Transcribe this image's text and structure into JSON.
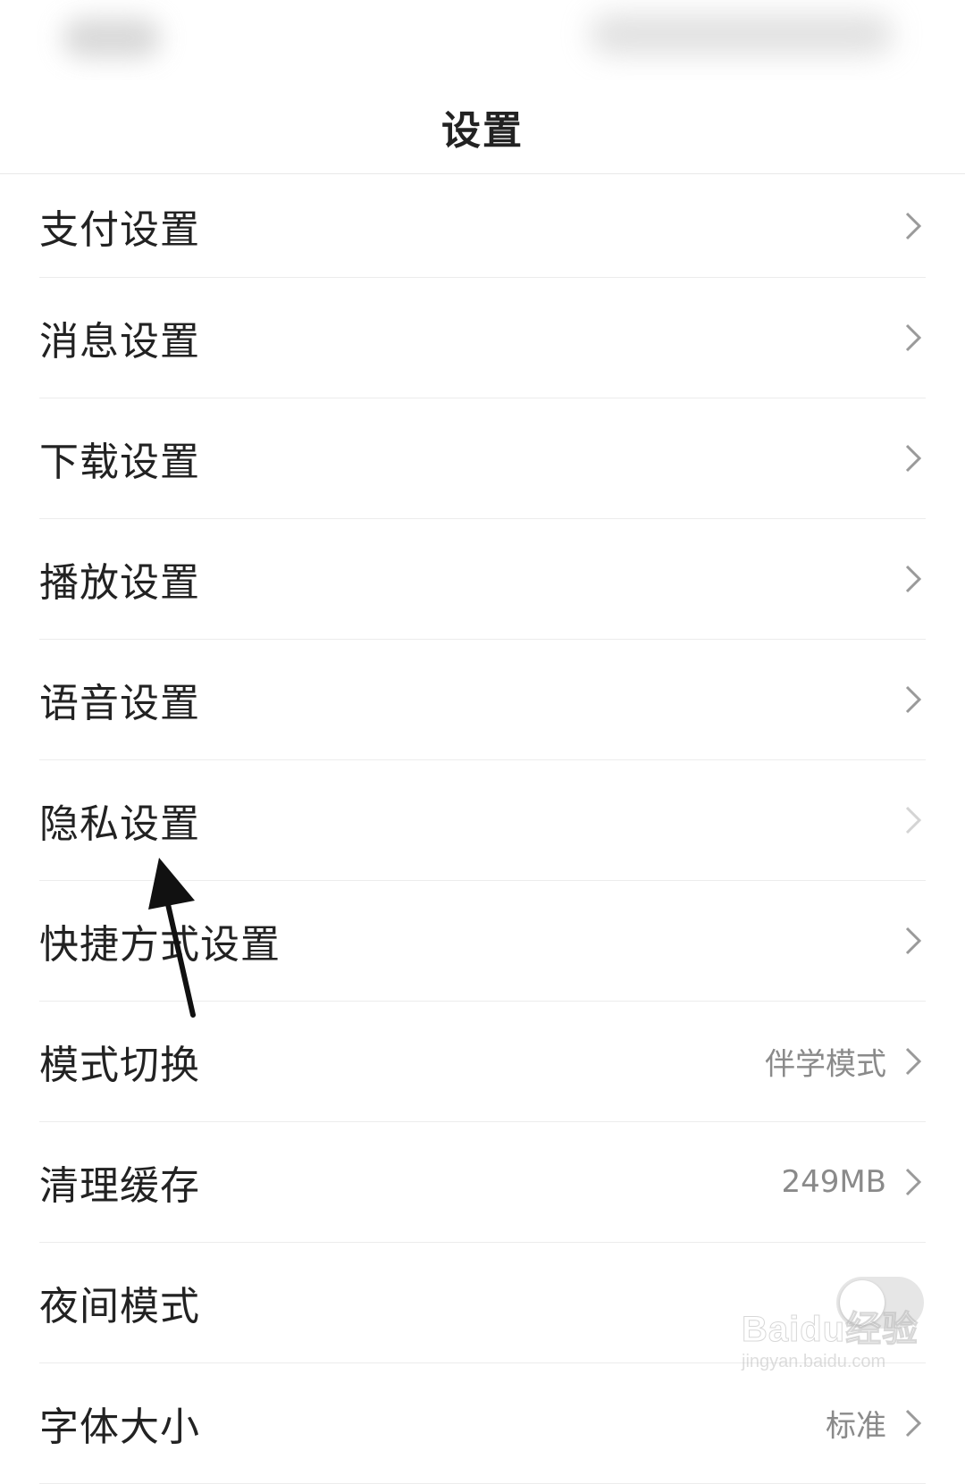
{
  "header": {
    "title": "设置"
  },
  "settings": {
    "items": [
      {
        "label": "支付设置"
      },
      {
        "label": "消息设置"
      },
      {
        "label": "下载设置"
      },
      {
        "label": "播放设置"
      },
      {
        "label": "语音设置"
      },
      {
        "label": "隐私设置"
      },
      {
        "label": "快捷方式设置"
      },
      {
        "label": "模式切换",
        "value": "伴学模式"
      },
      {
        "label": "清理缓存",
        "value": "249MB"
      },
      {
        "label": "夜间模式",
        "toggle": false
      },
      {
        "label": "字体大小",
        "value": "标准"
      }
    ]
  },
  "watermark": {
    "logo": "Baidu经验",
    "site": "jingyan.baidu.com"
  },
  "icons": {
    "chevron": "chevron-right-icon",
    "annotation": "annotation-arrow-icon"
  }
}
